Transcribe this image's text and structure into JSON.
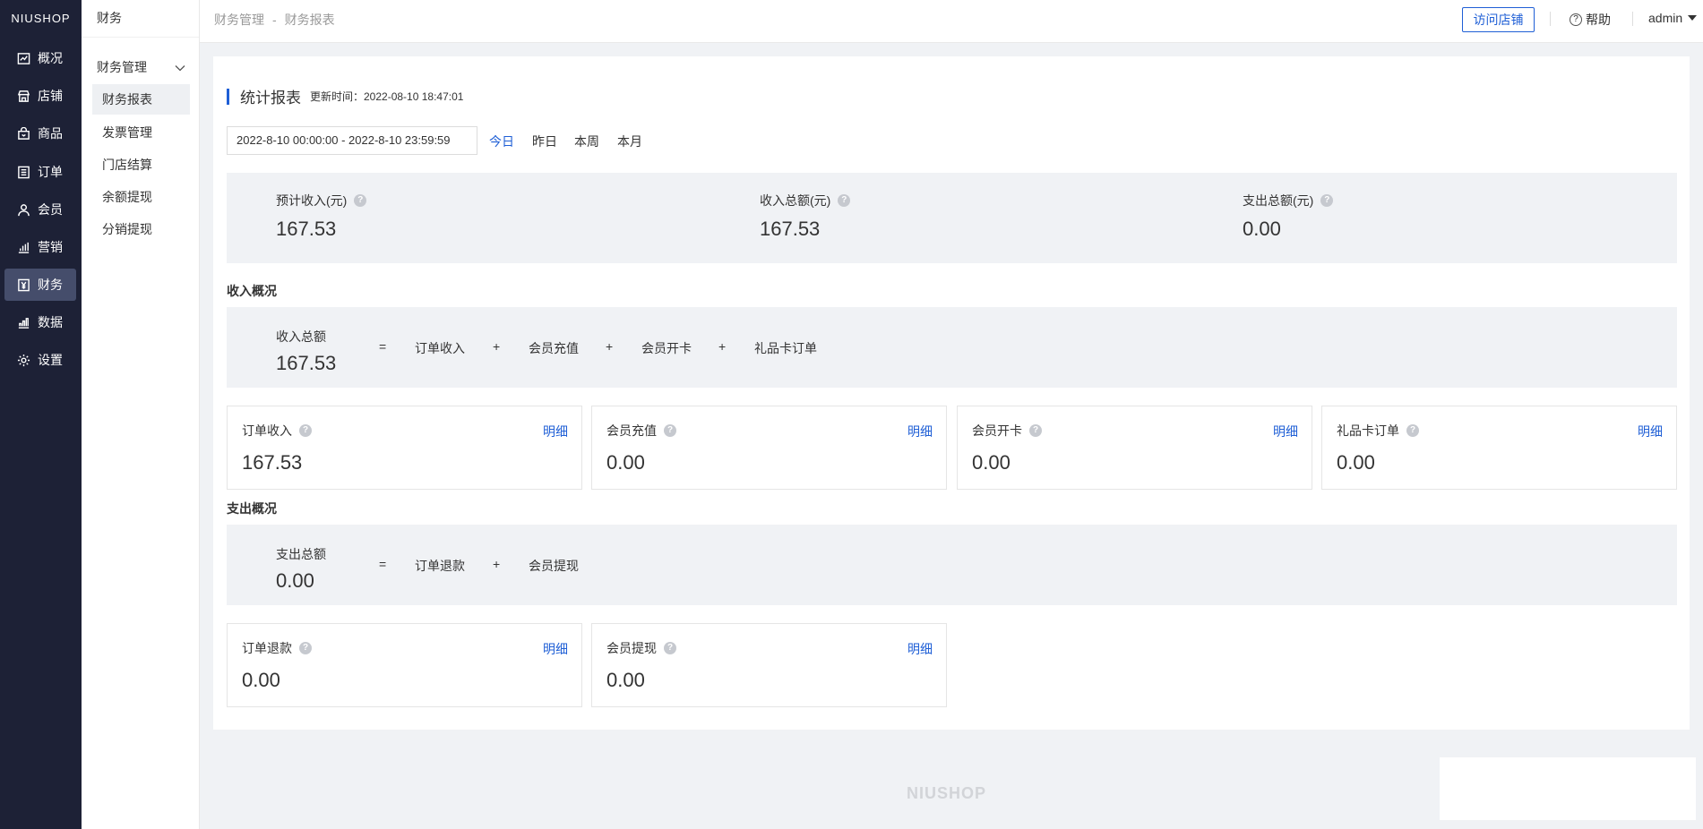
{
  "brand": "NIUSHOP",
  "sidebar": {
    "items": [
      {
        "label": "概况",
        "icon": "line-chart-icon"
      },
      {
        "label": "店铺",
        "icon": "store-icon"
      },
      {
        "label": "商品",
        "icon": "bag-icon"
      },
      {
        "label": "订单",
        "icon": "order-list-icon"
      },
      {
        "label": "会员",
        "icon": "user-icon"
      },
      {
        "label": "营销",
        "icon": "bar-chart-icon"
      },
      {
        "label": "财务",
        "icon": "yuan-icon"
      },
      {
        "label": "数据",
        "icon": "data-icon"
      },
      {
        "label": "设置",
        "icon": "gear-icon"
      }
    ],
    "active": "财务"
  },
  "subnav": {
    "title": "财务",
    "group": "财务管理",
    "items": [
      "财务报表",
      "发票管理",
      "门店结算",
      "余额提现",
      "分销提现"
    ],
    "active": "财务报表"
  },
  "header": {
    "breadcrumb": [
      "财务管理",
      "财务报表"
    ],
    "breadcrumb_sep": "-",
    "visit_store": "访问店铺",
    "help": "帮助",
    "user": "admin"
  },
  "report": {
    "title": "统计报表",
    "updated": "更新时间：2022-08-10 18:47:01",
    "date_range": "2022-8-10 00:00:00 - 2022-8-10 23:59:59",
    "quick_ranges": [
      "今日",
      "昨日",
      "本周",
      "本月"
    ],
    "active_range": "今日",
    "summary": [
      {
        "label": "预计收入(元)",
        "value": "167.53"
      },
      {
        "label": "收入总额(元)",
        "value": "167.53"
      },
      {
        "label": "支出总额(元)",
        "value": "0.00"
      }
    ],
    "income": {
      "section_title": "收入概况",
      "total_label": "收入总额",
      "total_value": "167.53",
      "equals": "=",
      "plus": "+",
      "terms": [
        "订单收入",
        "会员充值",
        "会员开卡",
        "礼品卡订单"
      ],
      "cards": [
        {
          "label": "订单收入",
          "value": "167.53",
          "link": "明细"
        },
        {
          "label": "会员充值",
          "value": "0.00",
          "link": "明细"
        },
        {
          "label": "会员开卡",
          "value": "0.00",
          "link": "明细"
        },
        {
          "label": "礼品卡订单",
          "value": "0.00",
          "link": "明细"
        }
      ]
    },
    "expense": {
      "section_title": "支出概况",
      "total_label": "支出总额",
      "total_value": "0.00",
      "equals": "=",
      "plus": "+",
      "terms": [
        "订单退款",
        "会员提现"
      ],
      "cards": [
        {
          "label": "订单退款",
          "value": "0.00",
          "link": "明细"
        },
        {
          "label": "会员提现",
          "value": "0.00",
          "link": "明细"
        }
      ]
    }
  },
  "footer": {
    "brand": "NIUSHOP"
  },
  "colors": {
    "accent": "#1f5fd6",
    "sidebar_bg": "#1d2136",
    "panel_bg": "#f0f2f5"
  }
}
